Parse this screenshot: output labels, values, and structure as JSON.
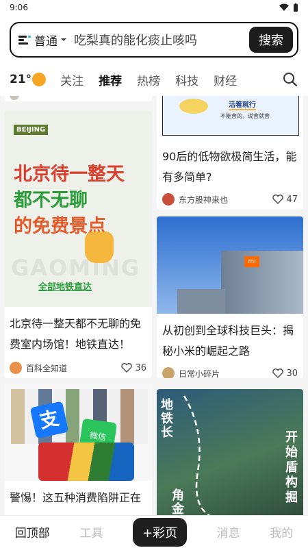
{
  "status": {
    "time": "9:06",
    "wifi_icon": "wifi-icon",
    "battery_icon": "battery-icon"
  },
  "search": {
    "scope": "普通",
    "query": "吃梨真的能化痰止咳吗",
    "button": "搜索"
  },
  "weather": {
    "temp": "21°",
    "icon": "sun-icon"
  },
  "tabs": [
    "关注",
    "推荐",
    "热榜",
    "科技",
    "财经"
  ],
  "active_tab": "推荐",
  "cards": [
    {
      "title": "北京待一整天都不无聊的免费室内场馆！地铁直达！",
      "author": "百科全知道",
      "likes": "36",
      "image": {
        "tag": "BEIJING",
        "line1": "北京待一整天",
        "line2": "都不无聊",
        "line3": "的免费景点",
        "footer": "全部地铁直达",
        "watermark": "GAOMING"
      }
    },
    {
      "title": "90后的低物欲极简生活，能有多简单?",
      "author": "东方股神来也",
      "likes": "47",
      "image": {
        "label1": "活着就行",
        "label2": "不能舍的，说舍就舍"
      }
    },
    {
      "title": "从初创到全球科技巨头：揭秘小米的崛起之路",
      "author": "日常小碎片",
      "likes": "30",
      "image": {
        "logo": "mi"
      }
    },
    {
      "title": "警惕！这五种消费陷阱正在",
      "image": {
        "alipay": "支",
        "wechat": "微信"
      }
    },
    {
      "image": {
        "left_text": "地铁长",
        "right_text": "开始盾构掘",
        "bottom_text": "角金舟"
      }
    }
  ],
  "bottom_nav": [
    "回顶部",
    "工具",
    "+彩页",
    "消息",
    "我的"
  ],
  "colors": {
    "accent": "#1d1d1d",
    "sun": "#f6a623",
    "green_text": "#2a9d3a",
    "red_text": "#d9412e"
  }
}
